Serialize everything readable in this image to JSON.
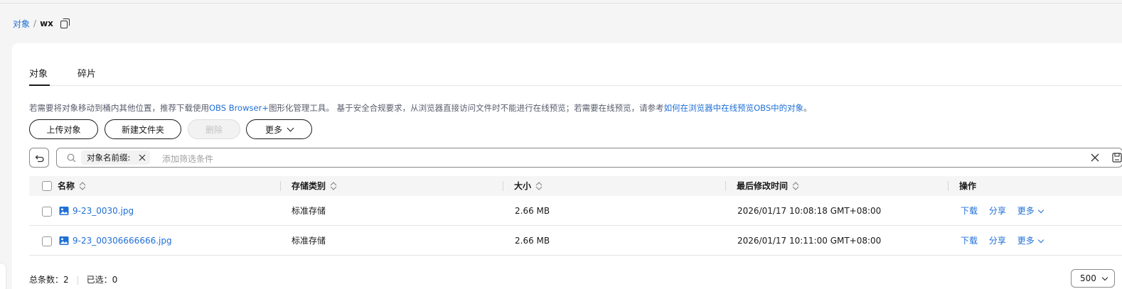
{
  "breadcrumb": {
    "root": "对象",
    "sep": "/",
    "current": "wx"
  },
  "tabs": [
    {
      "label": "对象"
    },
    {
      "label": "碎片"
    }
  ],
  "notice": {
    "part1": "若需要将对象移动到桶内其他位置，推荐下载使用",
    "link1": "OBS Browser+",
    "part2": "图形化管理工具。 基于安全合规要求，从浏览器直接访问文件时不能进行在线预览；若需要在线预览，请参考",
    "link2": "如何在浏览器中在线预览OBS中的对象",
    "part3": "。"
  },
  "toolbar": {
    "upload": "上传对象",
    "new_folder": "新建文件夹",
    "delete": "删除",
    "more": "更多"
  },
  "filter": {
    "chip_label": "对象名前缀:",
    "placeholder": "添加筛选条件"
  },
  "columns": {
    "name": "名称",
    "storage": "存储类别",
    "size": "大小",
    "modified": "最后修改时间",
    "actions": "操作"
  },
  "rows": [
    {
      "name": "9-23_0030.jpg",
      "storage": "标准存储",
      "size": "2.66 MB",
      "modified": "2026/01/17 10:08:18 GMT+08:00"
    },
    {
      "name": "9-23_00306666666.jpg",
      "storage": "标准存储",
      "size": "2.66 MB",
      "modified": "2026/01/17 10:11:00 GMT+08:00"
    }
  ],
  "row_actions": {
    "download": "下载",
    "share": "分享",
    "more": "更多"
  },
  "footer": {
    "total_label": "总条数：",
    "total": "2",
    "selected_label": "已选：",
    "selected": "0",
    "page_size": "500"
  },
  "colors": {
    "link": "#1f6fd6",
    "text": "#191919",
    "header_bg": "#f5f5f5"
  }
}
